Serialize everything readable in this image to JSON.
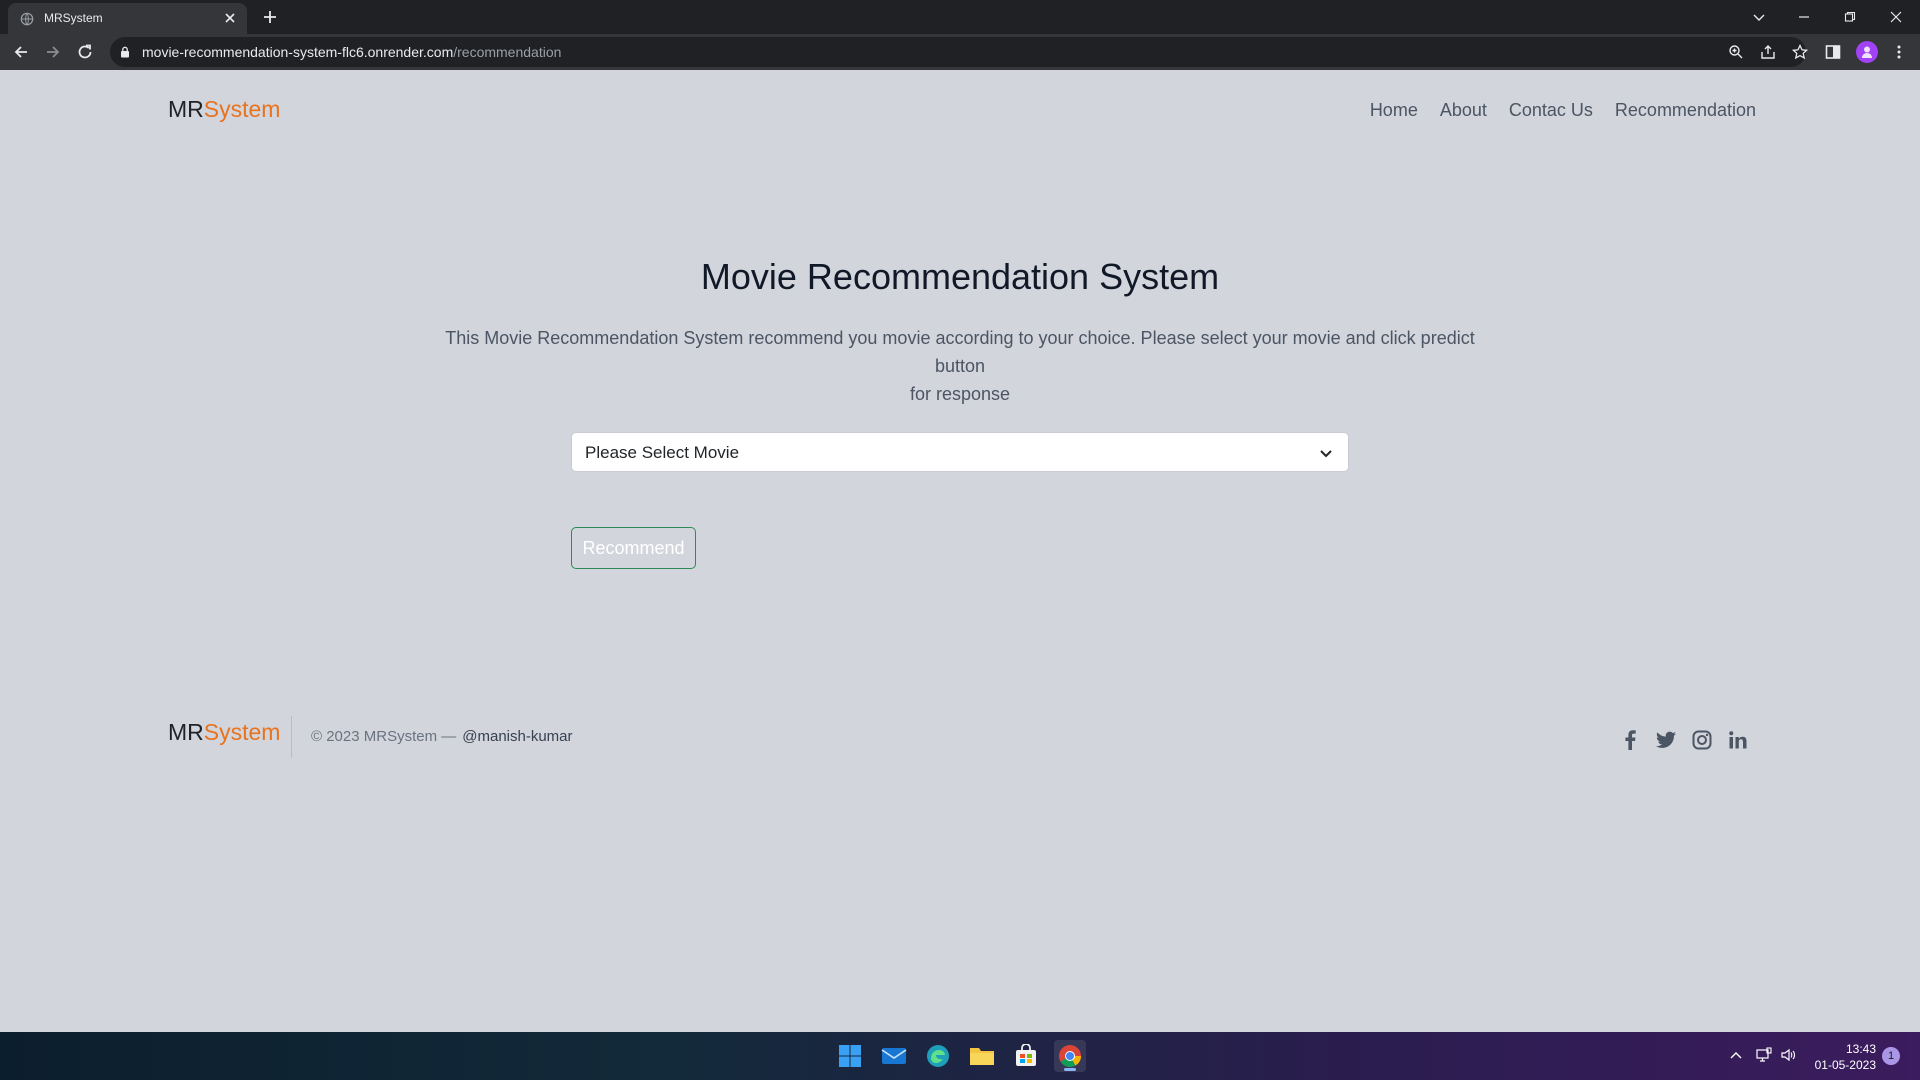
{
  "browser": {
    "tab_title": "MRSystem",
    "url_host": "movie-recommendation-system-flc6.onrender.com",
    "url_path": "/recommendation"
  },
  "header": {
    "logo_mr": "MR",
    "logo_system": "System",
    "nav": [
      "Home",
      "About",
      "Contac Us",
      "Recommendation"
    ]
  },
  "main": {
    "title": "Movie Recommendation System",
    "description_line1": "This Movie Recommendation System recommend you movie according to your choice. Please select your movie and click predict button",
    "description_line2": "for response",
    "select_placeholder": "Please Select Movie",
    "recommend_label": "Recommend"
  },
  "footer": {
    "logo_mr": "MR",
    "logo_system": "System",
    "copyright": "© 2023 MRSystem —",
    "handle": "@manish-kumar",
    "socials": [
      "facebook-icon",
      "twitter-icon",
      "instagram-icon",
      "linkedin-icon"
    ]
  },
  "taskbar": {
    "time": "13:43",
    "date": "01-05-2023",
    "notifications": "1"
  },
  "colors": {
    "page_bg": "#d2d5dc",
    "accent_orange": "#e8731f",
    "button_border": "#2e8b57"
  }
}
